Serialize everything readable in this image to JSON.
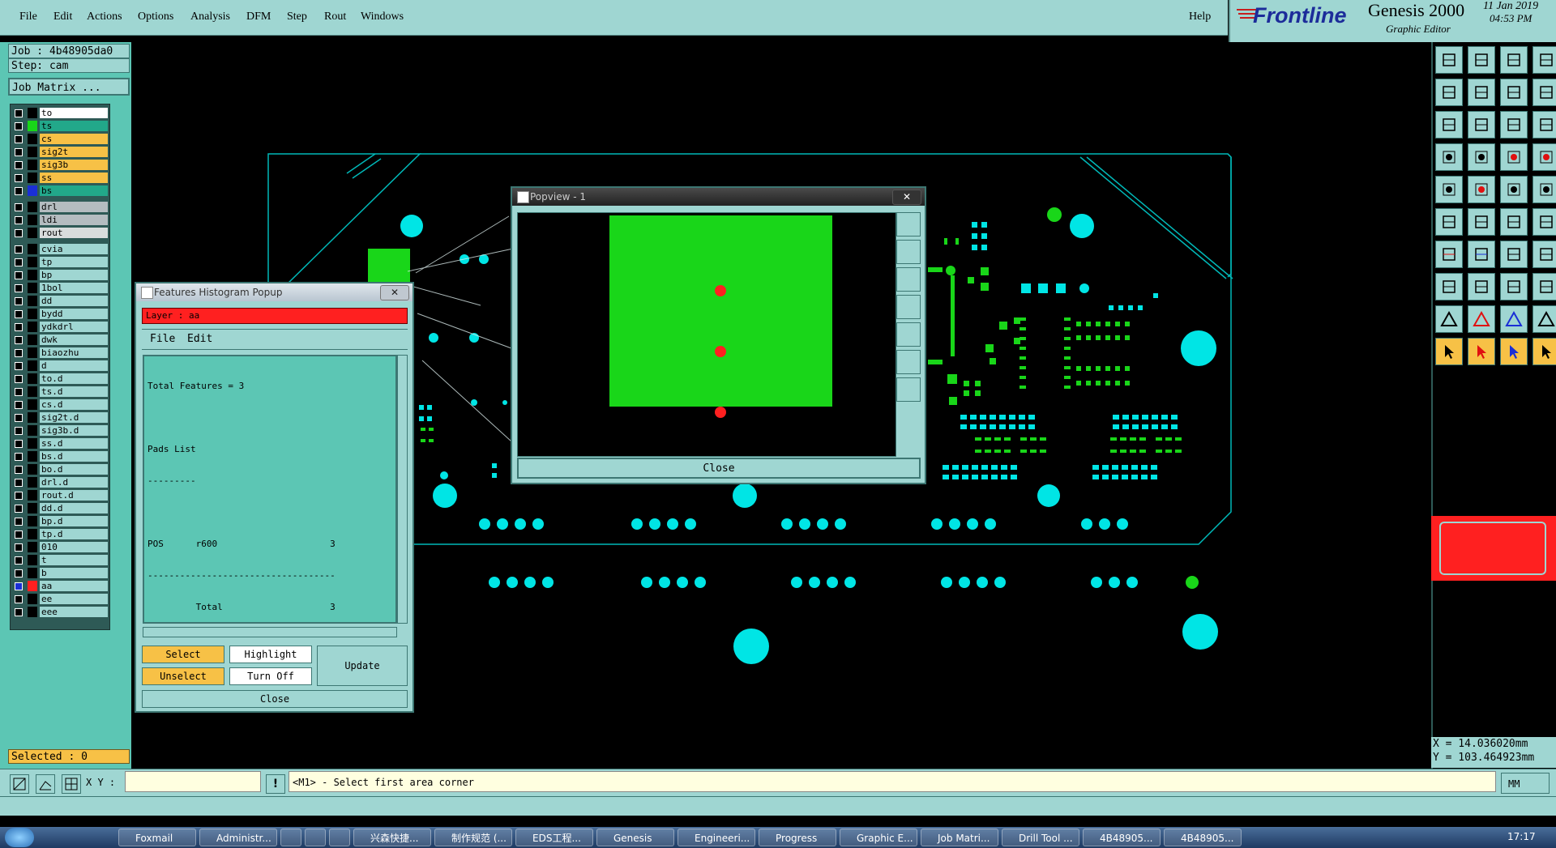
{
  "menu": {
    "items": [
      "File",
      "Edit",
      "Actions",
      "Options",
      "Analysis",
      "DFM",
      "Step",
      "Rout",
      "Windows"
    ],
    "help": "Help"
  },
  "brand": {
    "logo": "Frontline",
    "product": "Genesis 2000",
    "subtitle": "Graphic Editor",
    "date": "11 Jan 2019",
    "time": "04:53 PM"
  },
  "job": {
    "job_label": "Job : 4b48905da0",
    "step_label": "Step: cam",
    "matrix_button": "Job Matrix ..."
  },
  "layers": [
    {
      "name": "to",
      "color": "#000000",
      "bg": "#ffffff",
      "flag": true
    },
    {
      "name": "ts",
      "color": "#19d619",
      "bg": "#22a88a"
    },
    {
      "name": "cs",
      "color": "#000000",
      "bg": "#f7c146"
    },
    {
      "name": "sig2t",
      "color": "#000000",
      "bg": "#f7c146"
    },
    {
      "name": "sig3b",
      "color": "#000000",
      "bg": "#f7c146"
    },
    {
      "name": "ss",
      "color": "#000000",
      "bg": "#f7c146"
    },
    {
      "name": "bs",
      "color": "#1a2fd6",
      "bg": "#22a88a"
    },
    {
      "name": "drl",
      "color": "#000000",
      "bg": "#b4bcc0",
      "gap": true
    },
    {
      "name": "ldi",
      "color": "#000000",
      "bg": "#b4bcc0"
    },
    {
      "name": "rout",
      "color": "#000000",
      "bg": "#d8dcdc"
    },
    {
      "name": "cvia",
      "color": "#000000",
      "bg": "#9fd6d2",
      "gap": true
    },
    {
      "name": "tp",
      "color": "#000000",
      "bg": "#9fd6d2"
    },
    {
      "name": "bp",
      "color": "#000000",
      "bg": "#9fd6d2"
    },
    {
      "name": "1bol",
      "color": "#000000",
      "bg": "#9fd6d2"
    },
    {
      "name": "dd",
      "color": "#000000",
      "bg": "#9fd6d2"
    },
    {
      "name": "bydd",
      "color": "#000000",
      "bg": "#9fd6d2"
    },
    {
      "name": "ydkdrl",
      "color": "#000000",
      "bg": "#9fd6d2"
    },
    {
      "name": "dwk",
      "color": "#000000",
      "bg": "#9fd6d2"
    },
    {
      "name": "biaozhu",
      "color": "#000000",
      "bg": "#9fd6d2"
    },
    {
      "name": "d",
      "color": "#000000",
      "bg": "#9fd6d2"
    },
    {
      "name": "to.d",
      "color": "#000000",
      "bg": "#9fd6d2",
      "flag": true
    },
    {
      "name": "ts.d",
      "color": "#000000",
      "bg": "#9fd6d2"
    },
    {
      "name": "cs.d",
      "color": "#000000",
      "bg": "#9fd6d2"
    },
    {
      "name": "sig2t.d",
      "color": "#000000",
      "bg": "#9fd6d2"
    },
    {
      "name": "sig3b.d",
      "color": "#000000",
      "bg": "#9fd6d2"
    },
    {
      "name": "ss.d",
      "color": "#000000",
      "bg": "#9fd6d2"
    },
    {
      "name": "bs.d",
      "color": "#000000",
      "bg": "#9fd6d2"
    },
    {
      "name": "bo.d",
      "color": "#000000",
      "bg": "#9fd6d2"
    },
    {
      "name": "drl.d",
      "color": "#000000",
      "bg": "#9fd6d2"
    },
    {
      "name": "rout.d",
      "color": "#000000",
      "bg": "#9fd6d2"
    },
    {
      "name": "dd.d",
      "color": "#000000",
      "bg": "#9fd6d2"
    },
    {
      "name": "bp.d",
      "color": "#000000",
      "bg": "#9fd6d2"
    },
    {
      "name": "tp.d",
      "color": "#000000",
      "bg": "#9fd6d2"
    },
    {
      "name": "010",
      "color": "#000000",
      "bg": "#9fd6d2"
    },
    {
      "name": "t",
      "color": "#000000",
      "bg": "#9fd6d2"
    },
    {
      "name": "b",
      "color": "#000000",
      "bg": "#9fd6d2"
    },
    {
      "name": "aa",
      "color": "#ff2020",
      "bg": "#9fd6d2",
      "flag": true,
      "checked": true
    },
    {
      "name": "ee",
      "color": "#000000",
      "bg": "#9fd6d2"
    },
    {
      "name": "eee",
      "color": "#000000",
      "bg": "#9fd6d2"
    }
  ],
  "selected_label": "Selected : 0",
  "histogram": {
    "title": "Features Histogram Popup",
    "layer_label": "Layer :  aa",
    "menu": [
      "File",
      "Edit"
    ],
    "lines": [
      "Total Features = 3",
      "",
      "Pads List",
      "---------",
      "",
      "POS      r600                     3",
      "-----------------------------------",
      "         Total                    3"
    ],
    "buttons": {
      "select": "Select",
      "highlight": "Highlight",
      "update": "Update",
      "unselect": "Unselect",
      "turn_off": "Turn Off",
      "close": "Close"
    }
  },
  "popview": {
    "title": "Popview - 1",
    "close": "Close"
  },
  "coords": {
    "x": "X = 14.036020mm",
    "y": "Y = 103.464923mm"
  },
  "command": {
    "xy_label": "X Y :",
    "message": "<M1> - Select first area corner",
    "units": "MM"
  },
  "taskbar": {
    "items": [
      "Foxmail",
      "Administr...",
      "",
      "",
      "",
      "兴森快捷...",
      "制作规范 (...",
      "EDS工程...",
      "Genesis",
      "Engineeri...",
      "Progress",
      "Graphic E...",
      "Job Matri...",
      "Drill Tool ...",
      "4B48905...",
      "4B48905..."
    ],
    "clock": "17:17"
  },
  "colors": {
    "panel": "#9fd6d2",
    "panel_dark": "#5cc6b4",
    "board_cyan": "#00e5e5",
    "board_green": "#19d619",
    "highlight_red": "#ff2020",
    "accent_orange": "#f7c146"
  }
}
